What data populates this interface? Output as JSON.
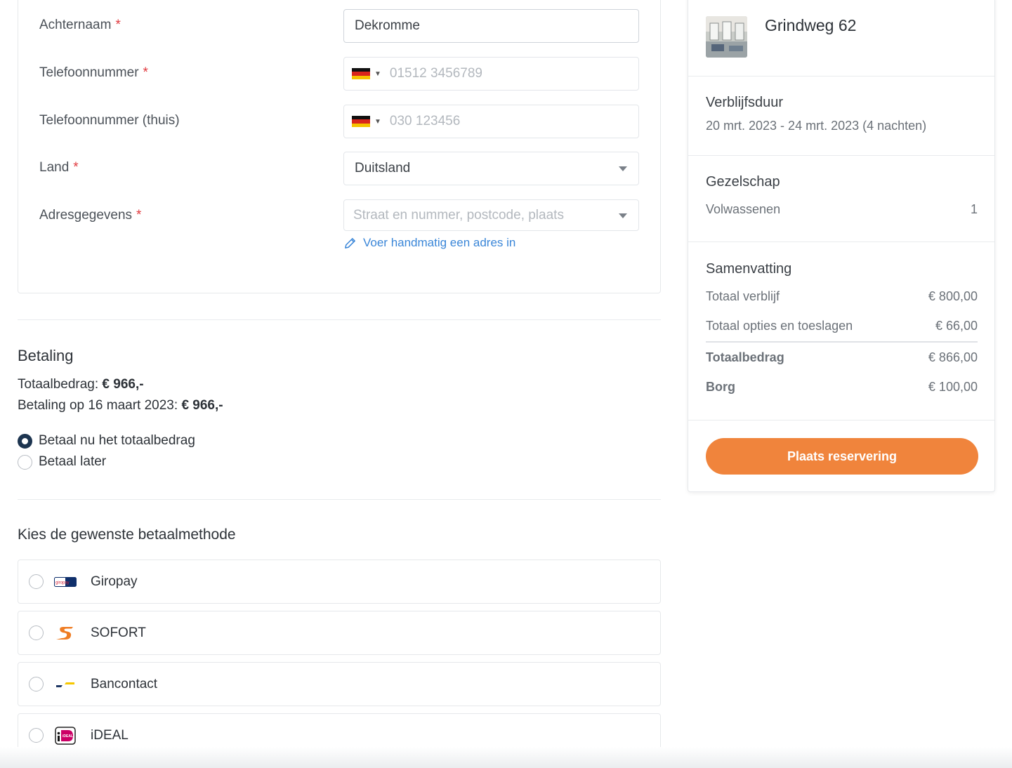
{
  "form": {
    "last_name": {
      "label": "Achternaam",
      "required": "*",
      "value": "Dekromme"
    },
    "phone": {
      "label": "Telefoonnummer",
      "required": "*",
      "placeholder": "01512 3456789",
      "flag": "germany-flag-icon"
    },
    "phone_home": {
      "label": "Telefoonnummer (thuis)",
      "placeholder": "030 123456",
      "flag": "germany-flag-icon"
    },
    "country": {
      "label": "Land",
      "required": "*",
      "value": "Duitsland"
    },
    "address": {
      "label": "Adresgegevens",
      "required": "*",
      "placeholder": "Straat en nummer, postcode, plaats"
    },
    "manual_address_link": "Voer handmatig een adres in"
  },
  "payment": {
    "title": "Betaling",
    "total_label": "Totaalbedrag: ",
    "total_value": "€ 966,-",
    "due_label": "Betaling op 16 maart 2023: ",
    "due_value": "€ 966,-",
    "options": [
      {
        "label": "Betaal nu het totaalbedrag",
        "checked": true
      },
      {
        "label": "Betaal later",
        "checked": false
      }
    ]
  },
  "methods": {
    "title": "Kies de gewenste betaalmethode",
    "items": [
      {
        "label": "Giropay",
        "icon": "giropay-icon",
        "logo_text": "giropay"
      },
      {
        "label": "SOFORT",
        "icon": "sofort-icon"
      },
      {
        "label": "Bancontact",
        "icon": "bancontact-icon"
      },
      {
        "label": "iDEAL",
        "icon": "ideal-icon",
        "logo_text": "iDEAL"
      }
    ]
  },
  "summary": {
    "property_name": "Grindweg 62",
    "stay": {
      "title": "Verblijfsduur",
      "dates": "20 mrt. 2023 - 24 mrt. 2023 (4 nachten)"
    },
    "party": {
      "title": "Gezelschap",
      "adults_label": "Volwassenen",
      "adults_count": "1"
    },
    "totals": {
      "title": "Samenvatting",
      "stay_label": "Totaal verblijf",
      "stay_value": "€ 800,00",
      "options_label": "Totaal opties en toeslagen",
      "options_value": "€ 66,00",
      "total_label": "Totaalbedrag",
      "total_value": "€ 866,00",
      "deposit_label": "Borg",
      "deposit_value": "€ 100,00"
    },
    "cta_label": "Plaats reservering"
  },
  "colors": {
    "accent": "#f0843c",
    "link": "#3a86d8",
    "required": "#e0393e",
    "radio_checked": "#1d3550"
  }
}
